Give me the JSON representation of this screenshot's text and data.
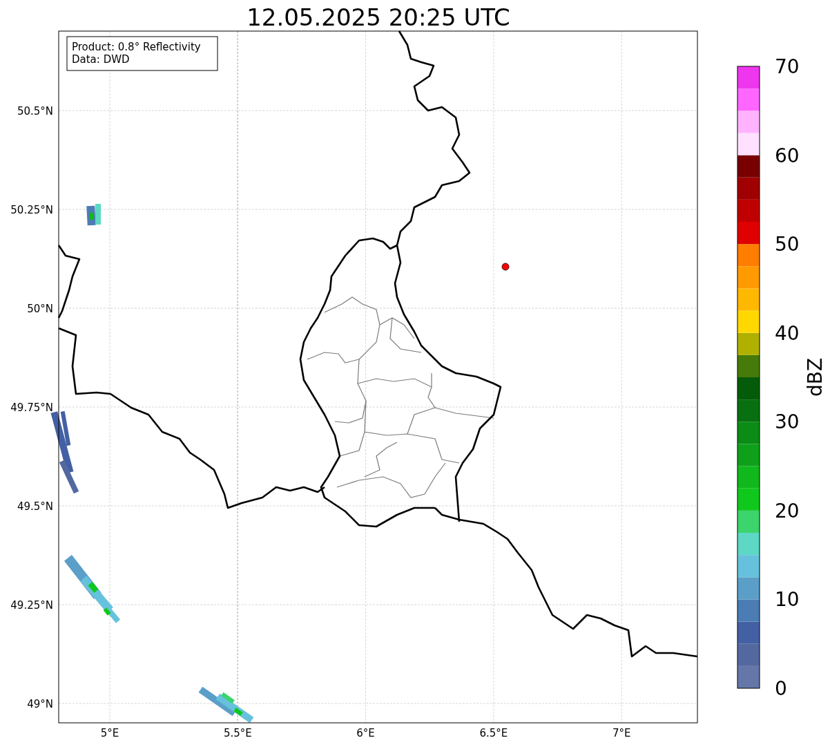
{
  "title": "12.05.2025 20:25 UTC",
  "info_box": [
    "Product: 0.8° Reflectivity",
    "Data: DWD"
  ],
  "lat_labels": [
    "50.5°N",
    "50.25°N",
    "50°N",
    "49.75°N",
    "49.5°N",
    "49.25°N",
    "49°N"
  ],
  "lon_labels": [
    "5°E",
    "5.5°E",
    "6°E",
    "6.5°E",
    "7°E"
  ],
  "colorbar": {
    "label": "dBZ",
    "ticks": [
      "70",
      "60",
      "50",
      "40",
      "30",
      "20",
      "10",
      "0"
    ],
    "segments": [
      {
        "color": "#6577a8"
      },
      {
        "color": "#5468a0"
      },
      {
        "color": "#4460a4"
      },
      {
        "color": "#4b7cb4"
      },
      {
        "color": "#5b9fc8"
      },
      {
        "color": "#66c2dc"
      },
      {
        "color": "#5cd8c4"
      },
      {
        "color": "#3cd46c"
      },
      {
        "color": "#10c81c"
      },
      {
        "color": "#10b81c"
      },
      {
        "color": "#0ea01a"
      },
      {
        "color": "#0a8c16"
      },
      {
        "color": "#087010"
      },
      {
        "color": "#045c0a"
      },
      {
        "color": "#467a0a"
      },
      {
        "color": "#b0b000"
      },
      {
        "color": "#ffd800"
      },
      {
        "color": "#ffb800"
      },
      {
        "color": "#ff9a00"
      },
      {
        "color": "#ff7d00"
      },
      {
        "color": "#e00000"
      },
      {
        "color": "#c00000"
      },
      {
        "color": "#a00000"
      },
      {
        "color": "#780000"
      },
      {
        "color": "#ffe0ff"
      },
      {
        "color": "#ffb3ff"
      },
      {
        "color": "#ff66ff"
      },
      {
        "color": "#ee36ee"
      }
    ]
  }
}
